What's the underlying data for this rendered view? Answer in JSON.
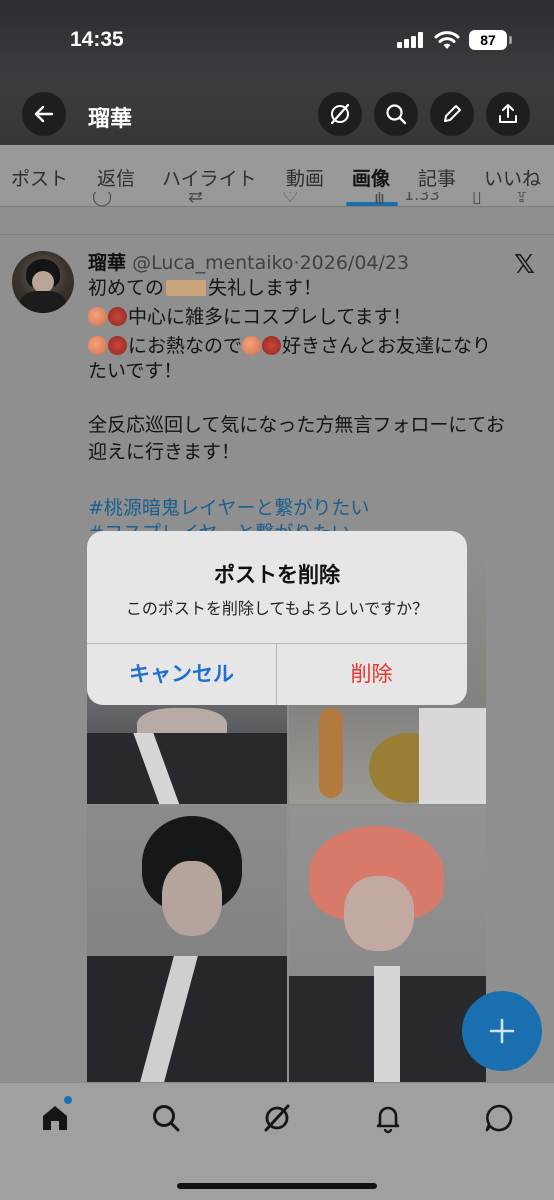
{
  "status_bar": {
    "time": "14:35",
    "battery": "87"
  },
  "header": {
    "title": "瑠華",
    "back_icon": "arrow-left-icon",
    "actions": [
      "grok-icon",
      "search-icon",
      "edit-icon",
      "share-icon"
    ]
  },
  "tabs": [
    {
      "label": "ポスト"
    },
    {
      "label": "返信"
    },
    {
      "label": "ハイライト"
    },
    {
      "label": "動画"
    },
    {
      "label": "画像",
      "active": true
    },
    {
      "label": "記事"
    },
    {
      "label": "いいね"
    }
  ],
  "previous_post": {
    "views": "1.33"
  },
  "post": {
    "name": "瑠華",
    "handle": "@Luca_mentaiko",
    "dot": "·",
    "date": "2026/04/23",
    "line1_before": "初めての",
    "line1_after": "失礼します！",
    "line2": "中心に雑多にコスプレしてます！",
    "line3": "にお熱なので",
    "line3_after": "好きさんとお友達になり",
    "line4": "たいです！",
    "line5": "全反応巡回して気になった方無言フォローにてお",
    "line6": "迎えに行きます！",
    "hashtag1": "#桃源暗鬼レイヤーと繋がりたい",
    "hashtag2": "#コスプレイヤーと繋がりたい"
  },
  "dialog": {
    "title": "ポストを削除",
    "message": "このポストを削除してもよろしいですか？",
    "cancel": "キャンセル",
    "delete": "削除"
  },
  "fab": {
    "icon": "plus-icon"
  },
  "bottom_nav": [
    "home-icon",
    "search-icon",
    "grok-icon",
    "notifications-icon",
    "messages-icon"
  ],
  "colors": {
    "accent": "#1a6fb0",
    "delete": "#e8342c",
    "cancel": "#1c6fd3"
  }
}
